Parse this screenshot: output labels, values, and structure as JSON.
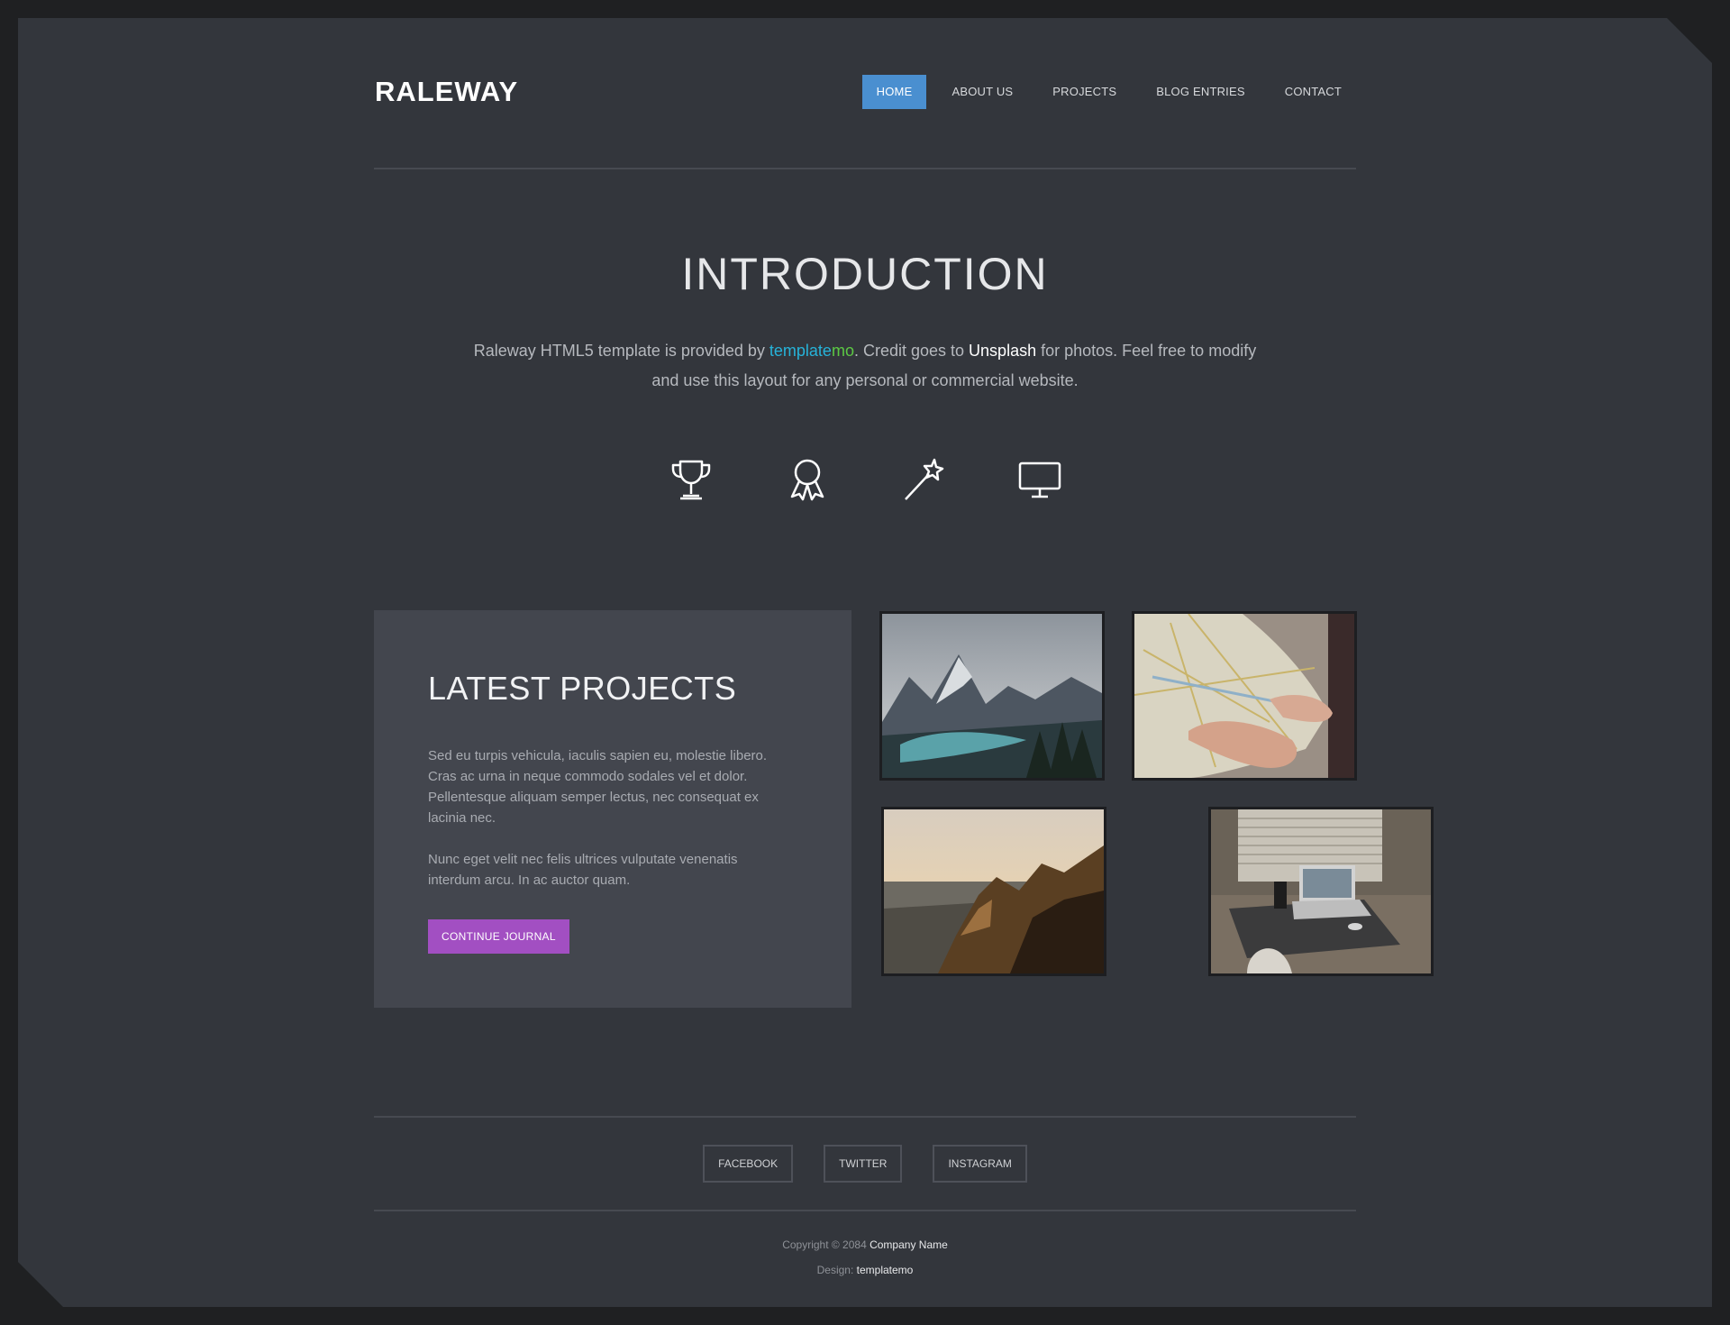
{
  "header": {
    "brand": "RALEWAY",
    "nav": [
      "HOME",
      "ABOUT US",
      "PROJECTS",
      "BLOG ENTRIES",
      "CONTACT"
    ]
  },
  "intro": {
    "title": "INTRODUCTION",
    "text_1": "Raleway HTML5 template is provided by ",
    "link_templatemo_a": "template",
    "link_templatemo_b": "mo",
    "text_2": ". Credit goes to ",
    "link_unsplash": "Unsplash",
    "text_3": " for photos. Feel free to modify and use this layout for any personal or commercial website.",
    "icons": [
      "trophy-icon",
      "award-ribbon-icon",
      "magic-wand-icon",
      "monitor-icon"
    ]
  },
  "projects": {
    "title": "LATEST PROJECTS",
    "paragraph_1": "Sed eu turpis vehicula, iaculis sapien eu, molestie libero. Cras ac urna in neque commodo sodales vel et dolor. Pellentesque aliquam semper lectus, nec consequat ex lacinia nec.",
    "paragraph_2": "Nunc eget velit nec felis ultrices vulputate venenatis interdum arcu. In ac auctor quam.",
    "button": "CONTINUE JOURNAL"
  },
  "footer": {
    "social": [
      "FACEBOOK",
      "TWITTER",
      "INSTAGRAM"
    ],
    "copyright_prefix": "Copyright © 2084 ",
    "company": "Company Name",
    "design_prefix": "Design: ",
    "design_link": "templatemo"
  },
  "colors": {
    "background": "#33363c",
    "nav_active": "#4a8fd0",
    "button": "#a24fc2",
    "link_blue": "#26b3d9",
    "link_green": "#5cc944"
  }
}
